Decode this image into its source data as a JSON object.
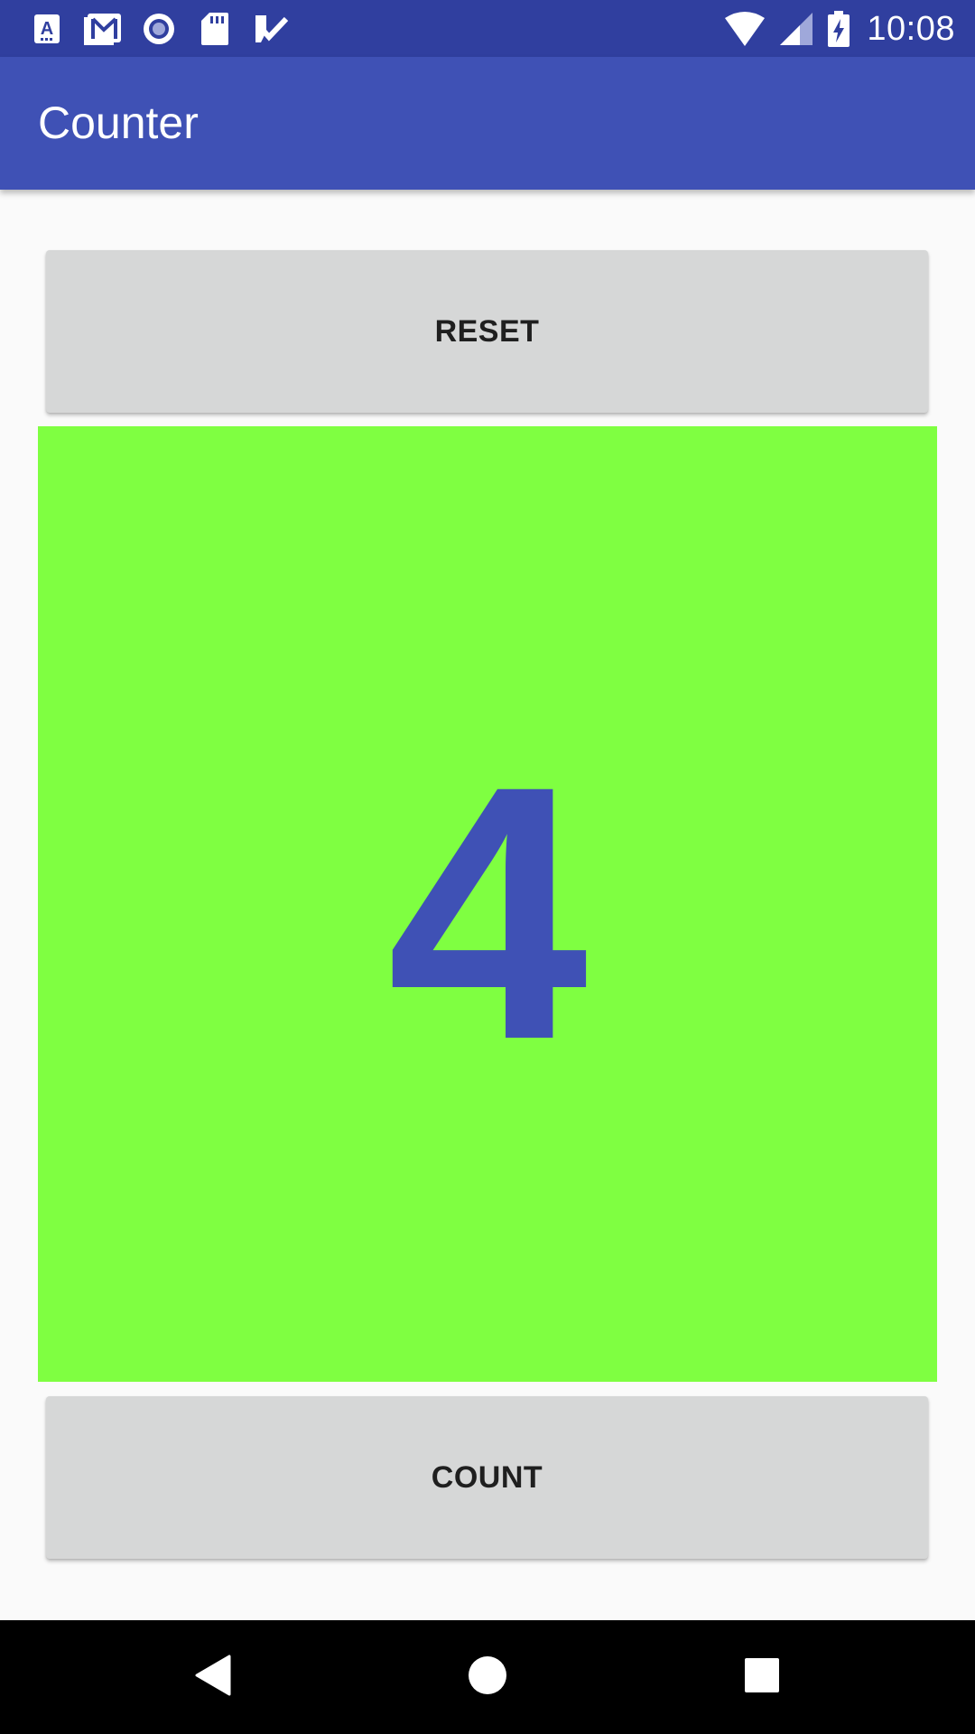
{
  "status_bar": {
    "time": "10:08",
    "notification_icons": [
      "font-app-icon",
      "gmail-icon",
      "record-icon",
      "sd-card-icon",
      "checklist-icon"
    ],
    "system_icons": [
      "wifi-icon",
      "signal-icon",
      "battery-charging-icon"
    ],
    "background_color": "#303f9f"
  },
  "app_bar": {
    "title": "Counter",
    "background_color": "#3f51b5"
  },
  "buttons": {
    "reset_label": "RESET",
    "count_label": "COUNT",
    "background_color": "#d6d7d7"
  },
  "counter": {
    "value": "4",
    "panel_color": "#7fff41",
    "text_color": "#3f51b5"
  },
  "nav_bar": {
    "icons": [
      "back-icon",
      "home-icon",
      "recents-icon"
    ]
  }
}
